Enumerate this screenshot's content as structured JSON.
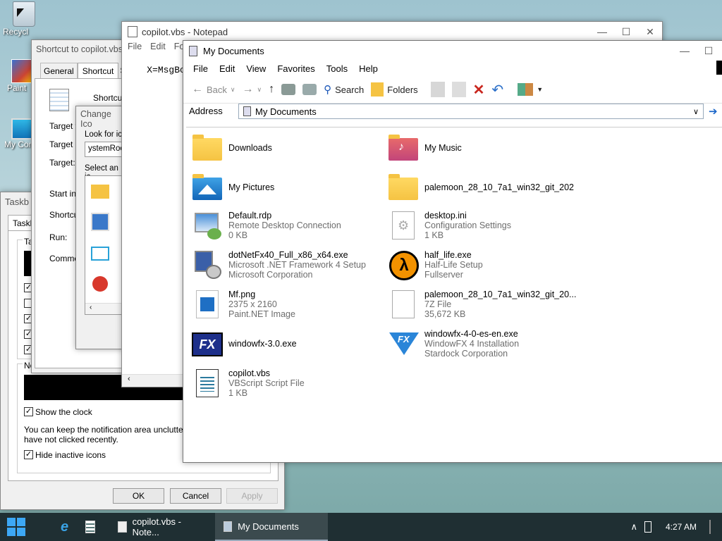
{
  "desktop": {
    "icons": [
      {
        "label": "Recycl",
        "icon": "recycle-bin-icon"
      },
      {
        "label": "Paint",
        "icon": "paint-icon"
      },
      {
        "label": "My Comp",
        "icon": "computer-icon"
      }
    ]
  },
  "taskprops": {
    "title": "Taskb",
    "tab": "Taskb",
    "show_clock": "Show the clock",
    "notif_text_1": "You can keep the notification area uncluttered b",
    "notif_text_2": "have not clicked recently.",
    "hide_inactive": "Hide inactive icons",
    "ok": "OK",
    "cancel": "Cancel",
    "apply": "Apply",
    "tab_ta": "Ta",
    "tab_no": "No"
  },
  "props": {
    "title": "Shortcut to copilot.vbs",
    "tabs": [
      "General",
      "Shortcut",
      "Se"
    ],
    "shortcut_label": "Shortcut",
    "fields": [
      "Target ty",
      "Target lo",
      "Target:",
      "Start in:",
      "Shortcut",
      "Run:",
      "Commen"
    ]
  },
  "changeicon": {
    "title": "Change Ico",
    "look_for": "Look for ic",
    "path": "ystemRoo",
    "select": "Select an ic"
  },
  "notepad": {
    "title": "copilot.vbs - Notepad",
    "menu": [
      "File",
      "Edit",
      "Fo"
    ],
    "content": "X=MsgBox(\""
  },
  "explorer": {
    "title": "My Documents",
    "menu": [
      "File",
      "Edit",
      "View",
      "Favorites",
      "Tools",
      "Help"
    ],
    "toolbar": {
      "back": "Back",
      "search": "Search",
      "folders": "Folders"
    },
    "address_label": "Address",
    "address_value": "My Documents",
    "files": [
      {
        "name": "Downloads",
        "line2": "",
        "line3": "",
        "icon": "folder-icon"
      },
      {
        "name": "My Music",
        "line2": "",
        "line3": "",
        "icon": "music-folder-icon"
      },
      {
        "name": "My Pictures",
        "line2": "",
        "line3": "",
        "icon": "pictures-folder-icon"
      },
      {
        "name": "palemoon_28_10_7a1_win32_git_202",
        "line2": "",
        "line3": "",
        "icon": "folder-icon"
      },
      {
        "name": "Default.rdp",
        "line2": "Remote Desktop Connection",
        "line3": "0 KB",
        "icon": "rdp-icon"
      },
      {
        "name": "desktop.ini",
        "line2": "Configuration Settings",
        "line3": "1 KB",
        "icon": "ini-file-icon"
      },
      {
        "name": "dotNetFx40_Full_x86_x64.exe",
        "line2": "Microsoft .NET Framework 4 Setup",
        "line3": "Microsoft Corporation",
        "icon": "installer-icon"
      },
      {
        "name": "half_life.exe",
        "line2": "Half-Life Setup",
        "line3": "Fullserver",
        "icon": "half-life-icon"
      },
      {
        "name": "Mf.png",
        "line2": "2375 x 2160",
        "line3": "Paint.NET Image",
        "icon": "image-file-icon"
      },
      {
        "name": "palemoon_28_10_7a1_win32_git_20...",
        "line2": "7Z File",
        "line3": "35,672 KB",
        "icon": "archive-file-icon"
      },
      {
        "name": "windowfx-3.0.exe",
        "line2": "",
        "line3": "",
        "icon": "windowfx-icon"
      },
      {
        "name": "windowfx-4-0-es-en.exe",
        "line2": "WindowFX 4 Installation",
        "line3": "Stardock Corporation",
        "icon": "windowfx4-icon"
      },
      {
        "name": "copilot.vbs",
        "line2": "VBScript Script File",
        "line3": "1 KB",
        "icon": "vbs-file-icon"
      }
    ]
  },
  "taskbar": {
    "items": [
      {
        "label": "copilot.vbs - Note...",
        "icon": "notepad-icon"
      },
      {
        "label": "My Documents",
        "icon": "explorer-icon"
      }
    ],
    "clock": "4:27 AM"
  }
}
